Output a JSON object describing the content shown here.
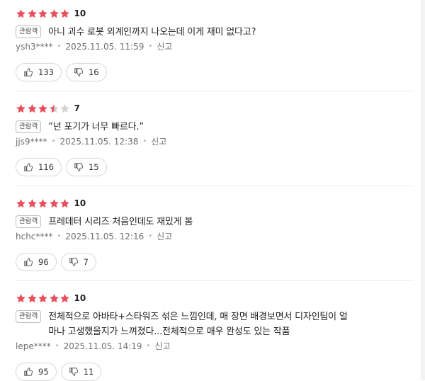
{
  "colors": {
    "star_filled": "#e8505b",
    "star_empty": "#d4d4d4"
  },
  "reviews": [
    {
      "stars": [
        1,
        1,
        1,
        1,
        1
      ],
      "score": "10",
      "badge": "관람객",
      "comment": "아니 괴수 로봇 외계인까지 나오는데 이게 재미 없다고?",
      "author": "ysh3****",
      "datetime": "2025.11.05. 11:59",
      "report": "신고",
      "likes": "133",
      "dislikes": "16"
    },
    {
      "stars": [
        1,
        1,
        1,
        0.5,
        0
      ],
      "score": "7",
      "badge": "관람객",
      "comment": "”넌 포기가 너무 빠르다.”",
      "author": "jjs9****",
      "datetime": "2025.11.05. 12:38",
      "report": "신고",
      "likes": "116",
      "dislikes": "15"
    },
    {
      "stars": [
        1,
        1,
        1,
        1,
        1
      ],
      "score": "10",
      "badge": "관람객",
      "comment": "프레데터 시리즈 처음인데도 재밌게 봄",
      "author": "hchc****",
      "datetime": "2025.11.05. 12:16",
      "report": "신고",
      "likes": "96",
      "dislikes": "7"
    },
    {
      "stars": [
        1,
        1,
        1,
        1,
        1
      ],
      "score": "10",
      "badge": "관람객",
      "comment_line1": "전체적으로 아바타+스타워즈 섞은 느낌인데, 매 장면 배경보면서 디자인팀이 얼",
      "comment_line2": "마나 고생했을지가 느껴졌다...전체적으로 매우 완성도 있는 작품",
      "author": "lepe****",
      "datetime": "2025.11.05. 14:19",
      "report": "신고",
      "likes": "95",
      "dislikes": "11"
    }
  ]
}
